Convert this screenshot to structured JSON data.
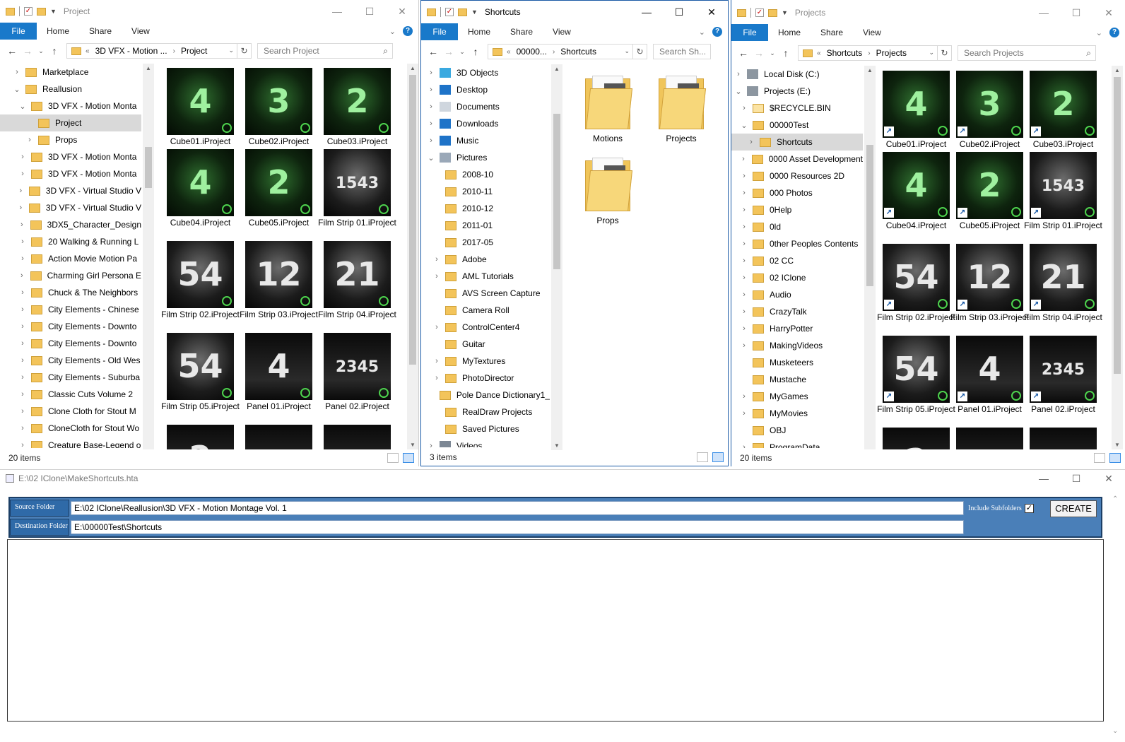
{
  "explorer_common": {
    "ribbon_tabs": [
      "File",
      "Home",
      "Share",
      "View"
    ],
    "help": "?"
  },
  "window_a": {
    "title": "Project",
    "breadcrumb": [
      "3D VFX - Motion ...",
      "Project"
    ],
    "overflow": "«",
    "search_placeholder": "Search Project",
    "status": "20 items",
    "nav": [
      {
        "label": "Marketplace",
        "chev": "›",
        "indent": 1
      },
      {
        "label": "Reallusion",
        "chev": "⌄",
        "indent": 1
      },
      {
        "label": "3D VFX - Motion Monta",
        "chev": "⌄",
        "indent": 2
      },
      {
        "label": "Project",
        "chev": "",
        "indent": 3,
        "selected": true
      },
      {
        "label": "Props",
        "chev": "›",
        "indent": 3
      },
      {
        "label": "3D VFX - Motion Monta",
        "chev": "›",
        "indent": 2
      },
      {
        "label": "3D VFX - Motion Monta",
        "chev": "›",
        "indent": 2
      },
      {
        "label": "3D VFX - Virtual Studio V",
        "chev": "›",
        "indent": 2
      },
      {
        "label": "3D VFX - Virtual Studio V",
        "chev": "›",
        "indent": 2
      },
      {
        "label": "3DX5_Character_Design",
        "chev": "›",
        "indent": 2
      },
      {
        "label": "20 Walking & Running L",
        "chev": "›",
        "indent": 2
      },
      {
        "label": "Action Movie Motion Pa",
        "chev": "›",
        "indent": 2
      },
      {
        "label": "Charming Girl Persona E",
        "chev": "›",
        "indent": 2
      },
      {
        "label": "Chuck & The Neighbors",
        "chev": "›",
        "indent": 2
      },
      {
        "label": "City Elements - Chinese",
        "chev": "›",
        "indent": 2
      },
      {
        "label": "City Elements - Downto",
        "chev": "›",
        "indent": 2
      },
      {
        "label": "City Elements - Downto",
        "chev": "›",
        "indent": 2
      },
      {
        "label": "City Elements - Old Wes",
        "chev": "›",
        "indent": 2
      },
      {
        "label": "City Elements - Suburba",
        "chev": "›",
        "indent": 2
      },
      {
        "label": "Classic Cuts Volume 2",
        "chev": "›",
        "indent": 2
      },
      {
        "label": "Clone Cloth for Stout M",
        "chev": "›",
        "indent": 2
      },
      {
        "label": "CloneCloth for Stout Wo",
        "chev": "›",
        "indent": 2
      },
      {
        "label": "Creature Base-Legend o",
        "chev": "›",
        "indent": 2
      }
    ]
  },
  "tiles": [
    {
      "label": "Cube01.iProject",
      "kind": "cube",
      "glyph": "4"
    },
    {
      "label": "Cube02.iProject",
      "kind": "cube",
      "glyph": "3"
    },
    {
      "label": "Cube03.iProject",
      "kind": "cube",
      "glyph": "2"
    },
    {
      "label": "Cube04.iProject",
      "kind": "cube",
      "glyph": "4"
    },
    {
      "label": "Cube05.iProject",
      "kind": "cube",
      "glyph": "2"
    },
    {
      "label": "Film Strip 01.iProject",
      "kind": "film",
      "glyph": "1543"
    },
    {
      "label": "Film Strip 02.iProject",
      "kind": "film",
      "glyph": "54"
    },
    {
      "label": "Film Strip 03.iProject",
      "kind": "film",
      "glyph": "12"
    },
    {
      "label": "Film Strip 04.iProject",
      "kind": "film",
      "glyph": "21"
    },
    {
      "label": "Film Strip 05.iProject",
      "kind": "film",
      "glyph": "54"
    },
    {
      "label": "Panel 01.iProject",
      "kind": "panel",
      "glyph": "4"
    },
    {
      "label": "Panel 02.iProject",
      "kind": "panel",
      "glyph": "2345"
    },
    {
      "label": "",
      "kind": "panel",
      "glyph": "2"
    },
    {
      "label": "",
      "kind": "panel",
      "glyph": ""
    },
    {
      "label": "",
      "kind": "panel",
      "glyph": ""
    }
  ],
  "window_b": {
    "title": "Shortcuts",
    "breadcrumb": [
      "00000...",
      "Shortcuts"
    ],
    "overflow": "«",
    "search_placeholder": "Search Sh...",
    "status": "3 items",
    "nav": [
      {
        "label": "3D Objects",
        "chev": "›",
        "icon": "3d-objects-icon",
        "indent": 1
      },
      {
        "label": "Desktop",
        "chev": "›",
        "icon": "desktop-icon",
        "indent": 1
      },
      {
        "label": "Documents",
        "chev": "›",
        "icon": "documents-icon",
        "indent": 1
      },
      {
        "label": "Downloads",
        "chev": "›",
        "icon": "downloads-icon",
        "indent": 1
      },
      {
        "label": "Music",
        "chev": "›",
        "icon": "music-icon",
        "indent": 1
      },
      {
        "label": "Pictures",
        "chev": "⌄",
        "icon": "pictures-icon",
        "indent": 1
      },
      {
        "label": "2008-10",
        "chev": "",
        "indent": 2
      },
      {
        "label": "2010-11",
        "chev": "",
        "indent": 2
      },
      {
        "label": "2010-12",
        "chev": "",
        "indent": 2
      },
      {
        "label": "2011-01",
        "chev": "",
        "indent": 2
      },
      {
        "label": "2017-05",
        "chev": "",
        "indent": 2
      },
      {
        "label": "Adobe",
        "chev": "›",
        "indent": 2
      },
      {
        "label": "AML Tutorials",
        "chev": "›",
        "indent": 2
      },
      {
        "label": "AVS Screen Capture",
        "chev": "",
        "indent": 2
      },
      {
        "label": "Camera Roll",
        "chev": "",
        "indent": 2
      },
      {
        "label": "ControlCenter4",
        "chev": "›",
        "indent": 2
      },
      {
        "label": "Guitar",
        "chev": "",
        "indent": 2
      },
      {
        "label": "MyTextures",
        "chev": "›",
        "indent": 2
      },
      {
        "label": "PhotoDirector",
        "chev": "›",
        "indent": 2
      },
      {
        "label": "Pole Dance Dictionary1_",
        "chev": "",
        "indent": 2
      },
      {
        "label": "RealDraw Projects",
        "chev": "",
        "indent": 2
      },
      {
        "label": "Saved Pictures",
        "chev": "",
        "indent": 2
      },
      {
        "label": "Videos",
        "chev": "›",
        "icon": "videos-icon",
        "indent": 1
      }
    ],
    "folders": [
      "Motions",
      "Projects",
      "Props"
    ]
  },
  "window_c": {
    "title": "Projects",
    "breadcrumb": [
      "Shortcuts",
      "Projects"
    ],
    "overflow": "«",
    "search_placeholder": "Search Projects",
    "status": "20 items",
    "nav": [
      {
        "label": "Local Disk (C:)",
        "chev": "›",
        "icon": "drive-icon",
        "indent": 1
      },
      {
        "label": "Projects (E:)",
        "chev": "⌄",
        "icon": "drive-icon",
        "indent": 1
      },
      {
        "label": "$RECYCLE.BIN",
        "chev": "›",
        "indent": 2,
        "light": true
      },
      {
        "label": "00000Test",
        "chev": "⌄",
        "indent": 2
      },
      {
        "label": "Shortcuts",
        "chev": "›",
        "indent": 3,
        "selected": true
      },
      {
        "label": "0000 Asset Development",
        "chev": "›",
        "indent": 2
      },
      {
        "label": "0000 Resources 2D",
        "chev": "›",
        "indent": 2
      },
      {
        "label": "000 Photos",
        "chev": "›",
        "indent": 2
      },
      {
        "label": "0Help",
        "chev": "›",
        "indent": 2
      },
      {
        "label": "0ld",
        "chev": "›",
        "indent": 2
      },
      {
        "label": "0ther Peoples Contents",
        "chev": "›",
        "indent": 2
      },
      {
        "label": "02 CC",
        "chev": "›",
        "indent": 2
      },
      {
        "label": "02 IClone",
        "chev": "›",
        "indent": 2
      },
      {
        "label": "Audio",
        "chev": "›",
        "indent": 2
      },
      {
        "label": "CrazyTalk",
        "chev": "›",
        "indent": 2
      },
      {
        "label": "HarryPotter",
        "chev": "›",
        "indent": 2
      },
      {
        "label": "MakingVideos",
        "chev": "›",
        "indent": 2
      },
      {
        "label": "Musketeers",
        "chev": "",
        "indent": 2
      },
      {
        "label": "Mustache",
        "chev": "",
        "indent": 2
      },
      {
        "label": "MyGames",
        "chev": "›",
        "indent": 2
      },
      {
        "label": "MyMovies",
        "chev": "›",
        "indent": 2
      },
      {
        "label": "OBJ",
        "chev": "",
        "indent": 2
      },
      {
        "label": "ProgramData",
        "chev": "›",
        "indent": 2
      }
    ]
  },
  "hta": {
    "title": "E:\\02 IClone\\MakeShortcuts.hta",
    "source_label": "Source Folder",
    "source_value": "E:\\02 IClone\\Reallusion\\3D VFX - Motion Montage Vol. 1",
    "dest_label": "Destination Folder",
    "dest_value": "E:\\00000Test\\Shortcuts",
    "include_label": "Include Subfolders",
    "include_checked": "✓",
    "create_label": "CREATE"
  },
  "window_controls": {
    "minimize": "—",
    "maximize": "☐",
    "close": "✕"
  }
}
